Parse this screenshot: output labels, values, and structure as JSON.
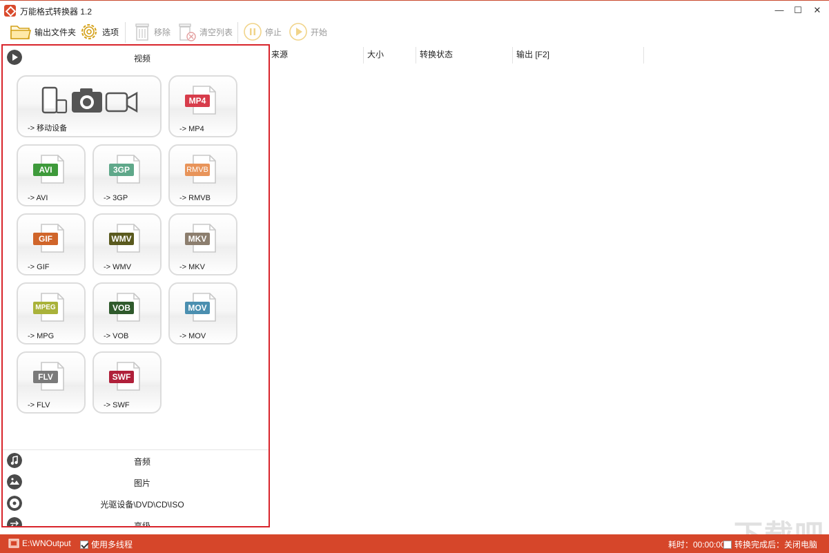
{
  "window": {
    "title": "万能格式转换器 1.2",
    "minimize": "—",
    "maximize": "☐",
    "close": "✕"
  },
  "toolbar": {
    "output_folder": "输出文件夹",
    "options": "选项",
    "remove": "移除",
    "clear_list": "清空列表",
    "stop": "停止",
    "start": "开始"
  },
  "sections": {
    "video": "视频",
    "audio": "音频",
    "image": "图片",
    "disc": "光驱设备\\DVD\\CD\\ISO",
    "advanced": "高级"
  },
  "tiles": [
    {
      "label": "-> 移动设备",
      "badge": ""
    },
    {
      "label": "-> MP4",
      "badge": "MP4",
      "color": "#d73c4b"
    },
    {
      "label": "-> AVI",
      "badge": "AVI",
      "color": "#3e9a3b"
    },
    {
      "label": "-> 3GP",
      "badge": "3GP",
      "color": "#5fa88a"
    },
    {
      "label": "-> RMVB",
      "badge": "RMVB",
      "color": "#e8945a"
    },
    {
      "label": "-> GIF",
      "badge": "GIF",
      "color": "#d0652a"
    },
    {
      "label": "-> WMV",
      "badge": "WMV",
      "color": "#5a5a1e"
    },
    {
      "label": "-> MKV",
      "badge": "MKV",
      "color": "#8c7e6e"
    },
    {
      "label": "-> MPG",
      "badge": "MPEG",
      "color": "#a9b23a"
    },
    {
      "label": "-> VOB",
      "badge": "VOB",
      "color": "#2f5a2c"
    },
    {
      "label": "-> MOV",
      "badge": "MOV",
      "color": "#4b8fb0"
    },
    {
      "label": "-> FLV",
      "badge": "FLV",
      "color": "#7a7a7a"
    },
    {
      "label": "-> SWF",
      "badge": "SWF",
      "color": "#b0203a"
    }
  ],
  "list": {
    "columns": [
      "来源",
      "大小",
      "转换状态",
      "输出 [F2]"
    ]
  },
  "status": {
    "output_path": "E:\\WNOutput",
    "multithread_label": "使用多线程",
    "multithread_checked": true,
    "elapsed_label": "耗时：00:00:00",
    "after_done_label": "转换完成后：关闭电脑",
    "after_done_checked": false
  },
  "watermark": "下载吧"
}
